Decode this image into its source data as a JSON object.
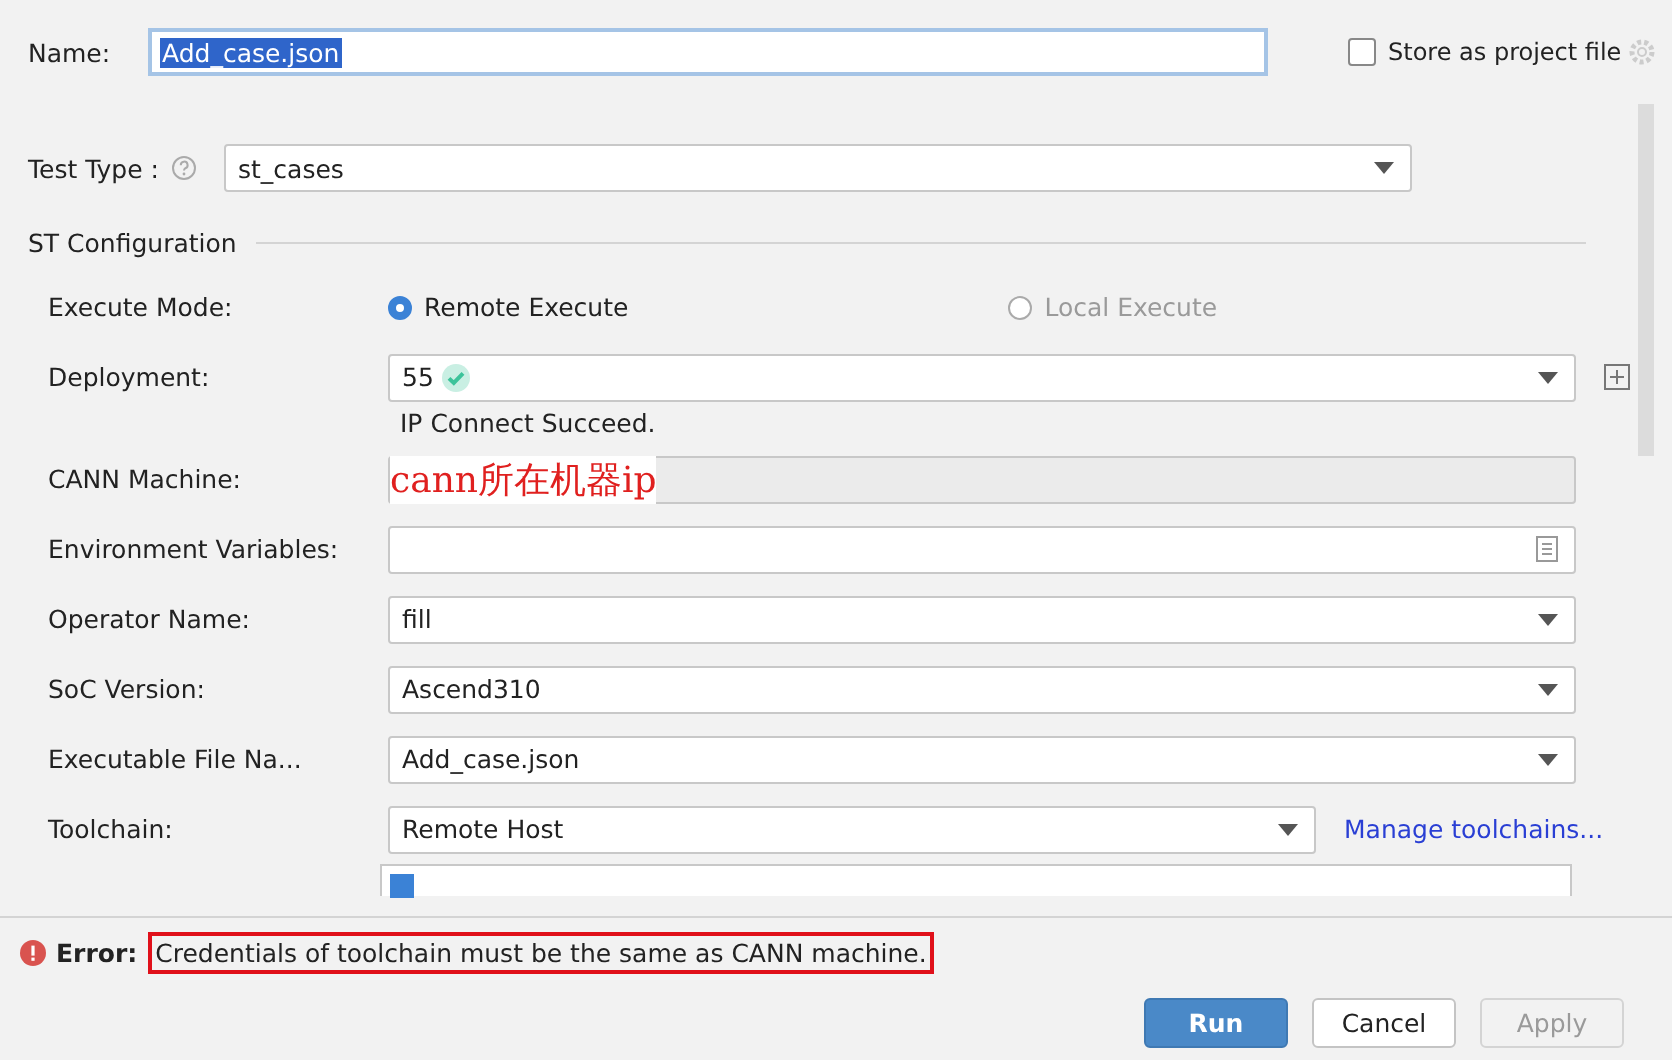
{
  "name_field": {
    "label": "Name:",
    "value": "Add_case.json"
  },
  "store_option": {
    "label": "Store as project file",
    "checked": false
  },
  "test_type": {
    "label": "Test Type :",
    "value": "st_cases"
  },
  "section_title": "ST Configuration",
  "rows": [
    {
      "kind": "radio",
      "label": "Execute Mode:",
      "options": [
        {
          "label": "Remote Execute",
          "selected": true,
          "disabled": false
        },
        {
          "label": "Local Execute",
          "selected": false,
          "disabled": true
        }
      ]
    },
    {
      "kind": "deployment",
      "label": "Deployment:",
      "value": "55",
      "verified": true,
      "status": "IP Connect Succeed."
    },
    {
      "kind": "readonly",
      "label": "CANN Machine:",
      "annotation": "cann所在机器ip"
    },
    {
      "kind": "env",
      "label": "Environment Variables:"
    },
    {
      "kind": "dropdown",
      "label": "Operator Name:",
      "value": "fill"
    },
    {
      "kind": "dropdown",
      "label": "SoC Version:",
      "value": "Ascend310"
    },
    {
      "kind": "dropdown",
      "label": "Executable File Na...",
      "value": "Add_case.json"
    },
    {
      "kind": "toolchain",
      "label": "Toolchain:",
      "value": "Remote Host",
      "link": "Manage toolchains..."
    },
    {
      "kind": "partial",
      "checked": true
    }
  ],
  "error": {
    "label": "Error:",
    "message": "Credentials of toolchain must be the same as CANN machine.",
    "highlighted": true
  },
  "buttons": [
    {
      "label": "Run",
      "kind": "primary",
      "disabled": false
    },
    {
      "label": "Cancel",
      "kind": "default",
      "disabled": false
    },
    {
      "label": "Apply",
      "kind": "default",
      "disabled": true
    }
  ]
}
